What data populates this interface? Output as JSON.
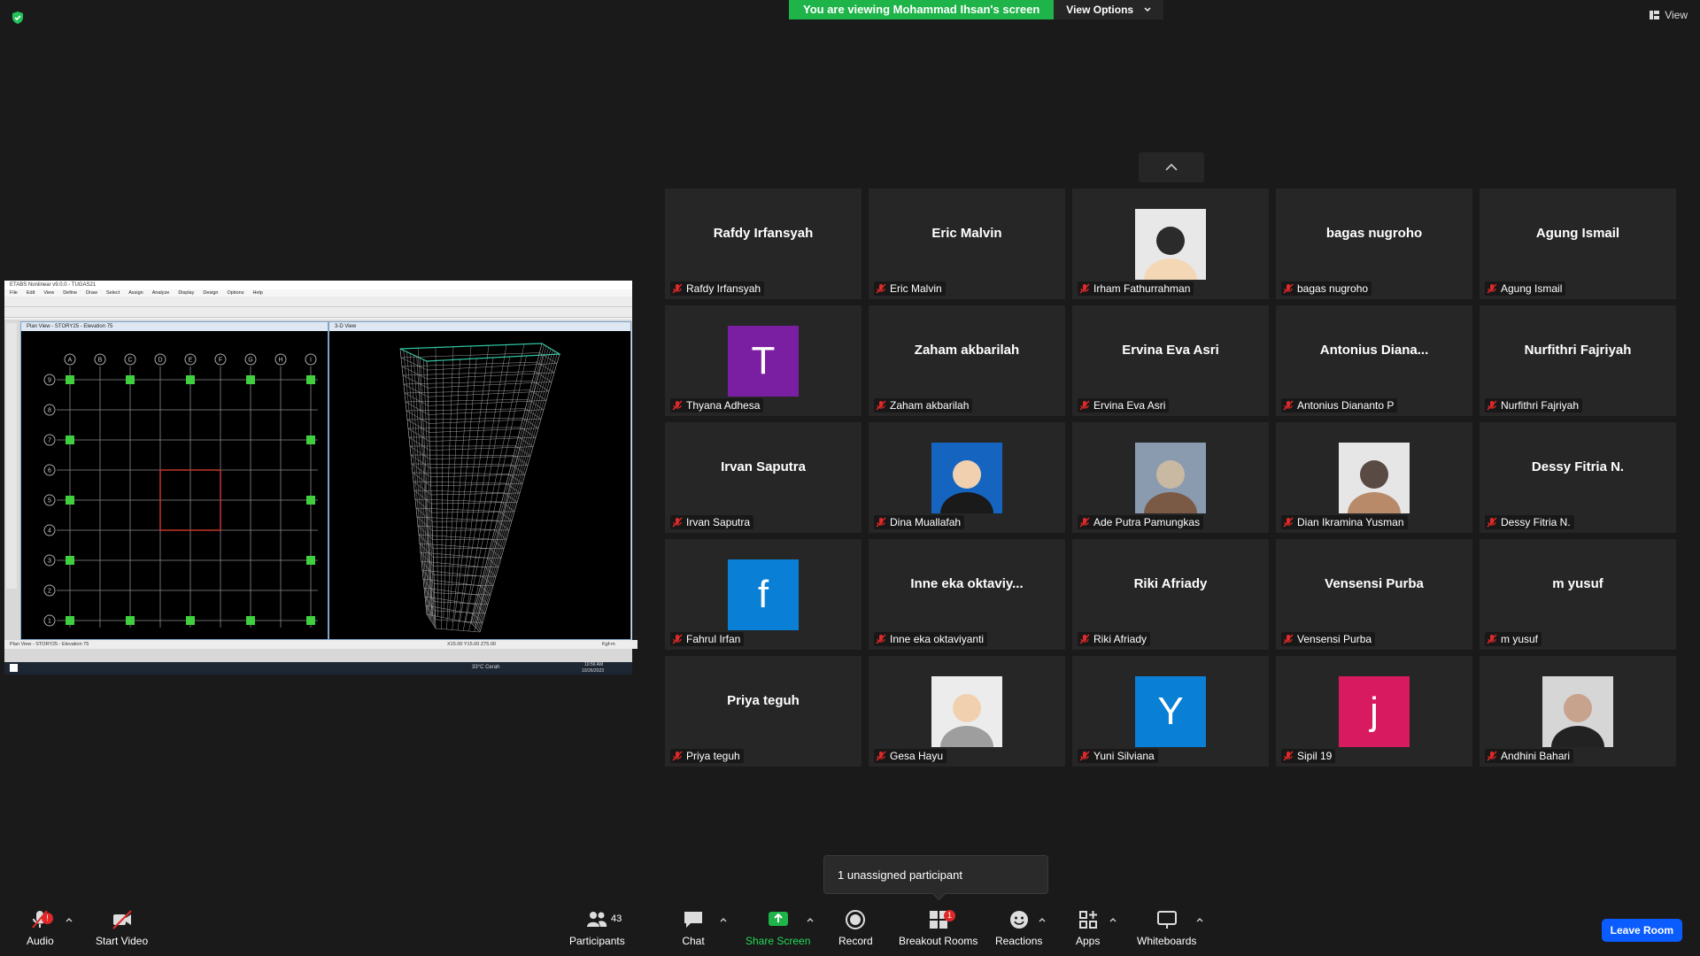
{
  "banner": {
    "viewing": "You are viewing Mohammad Ihsan's screen",
    "view_options": "View Options"
  },
  "top_right": {
    "view_label": "View"
  },
  "shared": {
    "title": "ETABS Nonlinear v9.0.0 - TUGAS21",
    "menu": [
      "File",
      "Edit",
      "View",
      "Define",
      "Draw",
      "Select",
      "Assign",
      "Analyze",
      "Display",
      "Design",
      "Options",
      "Help"
    ],
    "plan_title": "Plan View - STORY25 - Elevation 75",
    "view3d_title": "3-D View",
    "status_left": "Plan View - STORY25 - Elevation 75",
    "status_right": "X15.00 Y15.00 Z75.00",
    "status_units": "Kgf-m",
    "grid_cols": [
      "A",
      "B",
      "C",
      "D",
      "E",
      "F",
      "G",
      "H",
      "I"
    ],
    "grid_rows": [
      "9",
      "8",
      "7",
      "6",
      "5",
      "4",
      "3",
      "2",
      "1"
    ],
    "taskbar_weather": "33°C Cerah",
    "taskbar_time": "10:56 AM",
    "taskbar_date": "10/26/2023"
  },
  "participants": [
    {
      "name": "Rafdy Irfansyah",
      "display": "Rafdy Irfansyah",
      "type": "text"
    },
    {
      "name": "Eric Malvin",
      "display": "Eric Malvin",
      "type": "text"
    },
    {
      "name": "Irham Fathurrahman",
      "display": "",
      "type": "photo"
    },
    {
      "name": "bagas nugroho",
      "display": "bagas nugroho",
      "type": "text"
    },
    {
      "name": "Agung Ismail",
      "display": "Agung Ismail",
      "type": "text"
    },
    {
      "name": "Thyana Adhesa",
      "display": "T",
      "type": "avatar",
      "color": "#7b1fa2"
    },
    {
      "name": "Zaham akbarilah",
      "display": "Zaham akbarilah",
      "type": "text"
    },
    {
      "name": "Ervina Eva Asri",
      "display": "Ervina Eva Asri",
      "type": "text"
    },
    {
      "name": "Antonius Dianantо P",
      "display": "Antonius  Diana...",
      "type": "text"
    },
    {
      "name": "Nurfithri Fajriyah",
      "display": "Nurfithri Fajriyah",
      "type": "text"
    },
    {
      "name": "Irvan Saputra",
      "display": "Irvan Saputra",
      "type": "text"
    },
    {
      "name": "Dina Muallafah",
      "display": "",
      "type": "photo"
    },
    {
      "name": "Ade Putra Pamungkas",
      "display": "",
      "type": "photo"
    },
    {
      "name": "Dian Ikramina Yusman",
      "display": "",
      "type": "photo"
    },
    {
      "name": "Dessy Fitria N.",
      "display": "Dessy Fitria N.",
      "type": "text"
    },
    {
      "name": "Fahrul Irfan",
      "display": "f",
      "type": "avatar",
      "color": "#0a7fd6"
    },
    {
      "name": "Inne eka oktaviyanti",
      "display": "Inne  eka  oktaviy...",
      "type": "text"
    },
    {
      "name": "Riki Afriady",
      "display": "Riki Afriady",
      "type": "text"
    },
    {
      "name": "Vensensi Purba",
      "display": "Vensensi Purba",
      "type": "text"
    },
    {
      "name": "m yusuf",
      "display": "m yusuf",
      "type": "text"
    },
    {
      "name": "Priya teguh",
      "display": "Priya teguh",
      "type": "text"
    },
    {
      "name": "Gesa Hayu",
      "display": "",
      "type": "photo"
    },
    {
      "name": "Yuni Silviana",
      "display": "Y",
      "type": "avatar",
      "color": "#0a7fd6"
    },
    {
      "name": "Sipil 19",
      "display": "j",
      "type": "avatar",
      "color": "#d81b60"
    },
    {
      "name": "Andhini Bahari",
      "display": "",
      "type": "photo"
    }
  ],
  "tooltip": "1 unassigned participant",
  "toolbar": {
    "audio": "Audio",
    "audio_badge": "!",
    "video": "Start Video",
    "participants": "Participants",
    "participants_count": "43",
    "chat": "Chat",
    "share": "Share Screen",
    "record": "Record",
    "breakout": "Breakout Rooms",
    "breakout_badge": "1",
    "reactions": "Reactions",
    "apps": "Apps",
    "whiteboards": "Whiteboards",
    "leave": "Leave Room"
  }
}
